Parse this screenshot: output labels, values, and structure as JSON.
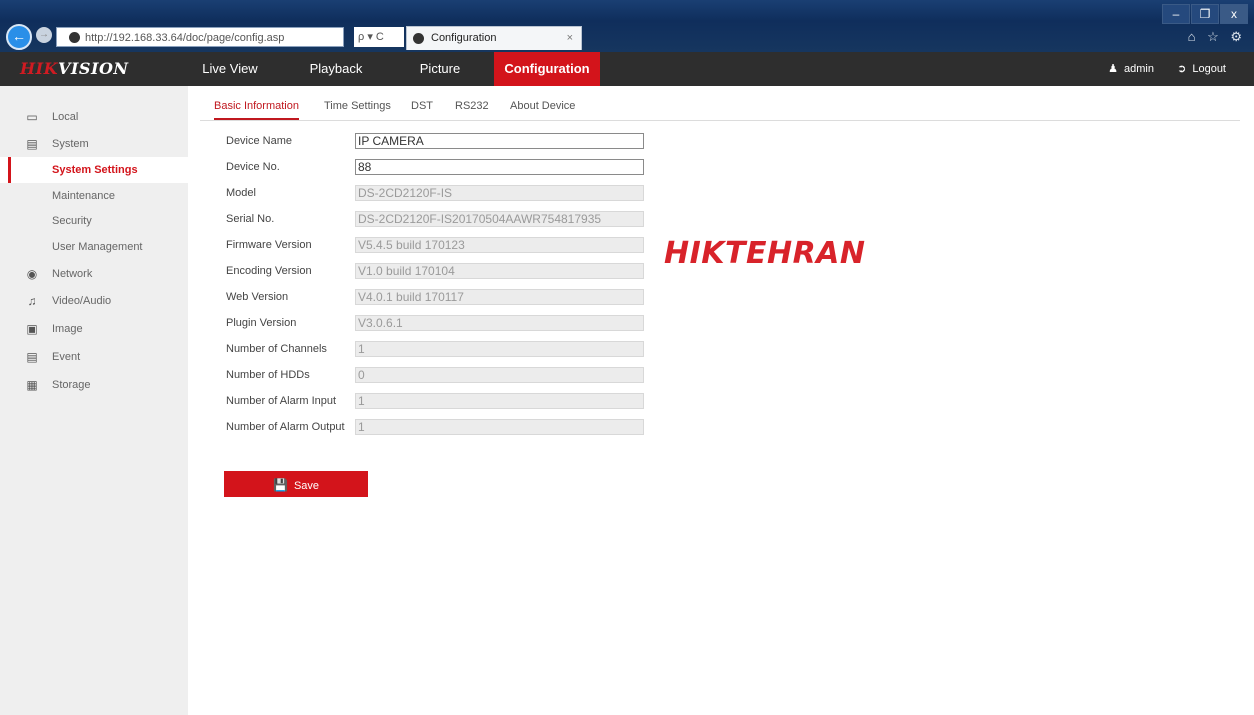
{
  "browser": {
    "url": "http://192.168.33.64/doc/page/config.asp",
    "search_tools": "ρ ▾ C",
    "tab_title": "Configuration",
    "tab_close": "×",
    "window_buttons": [
      "–",
      "❐",
      "x"
    ],
    "right_icons": "⌂ ☆ ⚙"
  },
  "topnav": {
    "logo_red": "HIK",
    "logo_white": "VISION",
    "items": [
      "Live View",
      "Playback",
      "Picture",
      "Configuration"
    ],
    "active": "Configuration",
    "user": "admin",
    "logout": "Logout"
  },
  "sidebar": {
    "items": [
      {
        "label": "Local",
        "icon": "monitor-icon"
      },
      {
        "label": "System",
        "icon": "system-icon"
      },
      {
        "label": "System Settings",
        "sub": true,
        "active": true
      },
      {
        "label": "Maintenance",
        "sub": true
      },
      {
        "label": "Security",
        "sub": true
      },
      {
        "label": "User Management",
        "sub": true
      },
      {
        "label": "Network",
        "icon": "globe-icon"
      },
      {
        "label": "Video/Audio",
        "icon": "video-audio-icon"
      },
      {
        "label": "Image",
        "icon": "image-icon"
      },
      {
        "label": "Event",
        "icon": "event-icon"
      },
      {
        "label": "Storage",
        "icon": "storage-icon"
      }
    ]
  },
  "content": {
    "tabs": [
      "Basic Information",
      "Time Settings",
      "DST",
      "RS232",
      "About Device"
    ],
    "active_tab": "Basic Information",
    "fields": [
      {
        "label": "Device Name",
        "value": "IP CAMERA",
        "editable": true
      },
      {
        "label": "Device No.",
        "value": "88",
        "editable": true
      },
      {
        "label": "Model",
        "value": "DS-2CD2120F-IS",
        "editable": false
      },
      {
        "label": "Serial No.",
        "value": "DS-2CD2120F-IS20170504AAWR754817935",
        "editable": false
      },
      {
        "label": "Firmware Version",
        "value": "V5.4.5 build 170123",
        "editable": false
      },
      {
        "label": "Encoding Version",
        "value": "V1.0 build 170104",
        "editable": false
      },
      {
        "label": "Web Version",
        "value": "V4.0.1 build 170117",
        "editable": false
      },
      {
        "label": "Plugin Version",
        "value": "V3.0.6.1",
        "editable": false
      },
      {
        "label": "Number of Channels",
        "value": "1",
        "editable": false
      },
      {
        "label": "Number of HDDs",
        "value": "0",
        "editable": false
      },
      {
        "label": "Number of Alarm Input",
        "value": "1",
        "editable": false
      },
      {
        "label": "Number of Alarm Output",
        "value": "1",
        "editable": false
      }
    ],
    "save_label": "Save"
  },
  "watermark": "HIKTEHRAN",
  "colors": {
    "accent": "#d3141b",
    "nav_bg": "#2e2e2e",
    "sidebar_bg": "#efefef"
  }
}
